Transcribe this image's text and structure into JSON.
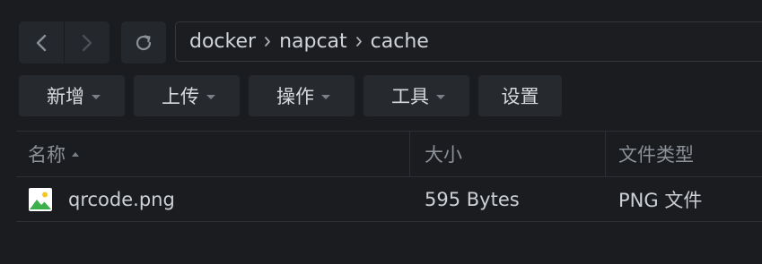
{
  "nav": {
    "back_icon": "chevron-left-icon",
    "forward_icon": "chevron-right-icon",
    "refresh_icon": "refresh-icon"
  },
  "breadcrumb": [
    {
      "label": "docker"
    },
    {
      "label": "napcat"
    },
    {
      "label": "cache"
    }
  ],
  "toolbar": {
    "new_label": "新增",
    "upload_label": "上传",
    "actions_label": "操作",
    "tools_label": "工具",
    "settings_label": "设置"
  },
  "table": {
    "columns": {
      "name": "名称",
      "size": "大小",
      "type": "文件类型"
    },
    "sort": {
      "column": "name",
      "direction": "ascending"
    },
    "rows": [
      {
        "name": "qrcode.png",
        "size": "595 Bytes",
        "type": "PNG 文件",
        "icon": "image-file-icon"
      }
    ]
  },
  "colors": {
    "background": "#1a1c1f",
    "button": "#262a2e",
    "text": "#d0d4d9",
    "icon_green": "#3daf4d",
    "icon_sun": "#f3c623"
  }
}
